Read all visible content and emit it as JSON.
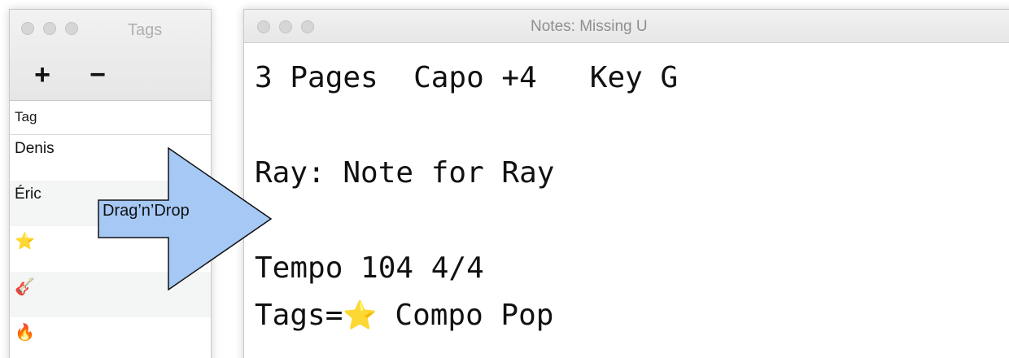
{
  "tags_window": {
    "title": "Tags",
    "add_label": "+",
    "remove_label": "−",
    "column_header": "Tag",
    "rows": [
      {
        "label": "Denis"
      },
      {
        "label": "Éric"
      },
      {
        "label": "⭐",
        "icon": "star-emoji-icon"
      },
      {
        "label": "🎸",
        "icon": "guitar-emoji-icon"
      },
      {
        "label": "🔥",
        "icon": "fire-emoji-icon"
      }
    ]
  },
  "notes_window": {
    "title": "Notes: Missing U",
    "lines": [
      "3 Pages  Capo +4   Key G",
      "",
      "Ray: Note for Ray",
      "",
      "Tempo 104 4/4"
    ],
    "tags_line_prefix": "Tags=",
    "tags_line_emoji": "⭐",
    "tags_line_suffix": " Compo Pop"
  },
  "drag_hint": {
    "label": "Drag’n’Drop",
    "arrow_color": "#a6c8f5"
  }
}
